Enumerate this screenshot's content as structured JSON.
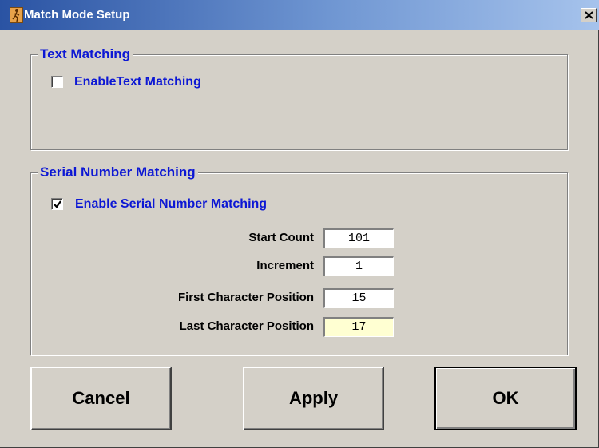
{
  "window": {
    "title": "Match Mode Setup",
    "icon": "runner-app-icon",
    "close_icon": "close-icon"
  },
  "text_matching": {
    "legend": "Text Matching",
    "checkbox_label": "EnableText Matching",
    "checked": false
  },
  "serial_matching": {
    "legend": "Serial Number Matching",
    "checkbox_label": "Enable Serial Number Matching",
    "checked": true,
    "fields": [
      {
        "label": "Start Count",
        "value": "101"
      },
      {
        "label": "Increment",
        "value": "1"
      },
      {
        "label": "First Character Position",
        "value": "15"
      },
      {
        "label": "Last Character Position",
        "value": "17"
      }
    ]
  },
  "buttons": {
    "cancel": "Cancel",
    "apply": "Apply",
    "ok": "OK"
  },
  "colors": {
    "title_bar_start": "#2a53a3",
    "title_bar_end": "#a6c3ec",
    "accent_text": "#0c17d4",
    "dialog_bg": "#d4d0c8",
    "highlight_field": "#ffffd2"
  }
}
